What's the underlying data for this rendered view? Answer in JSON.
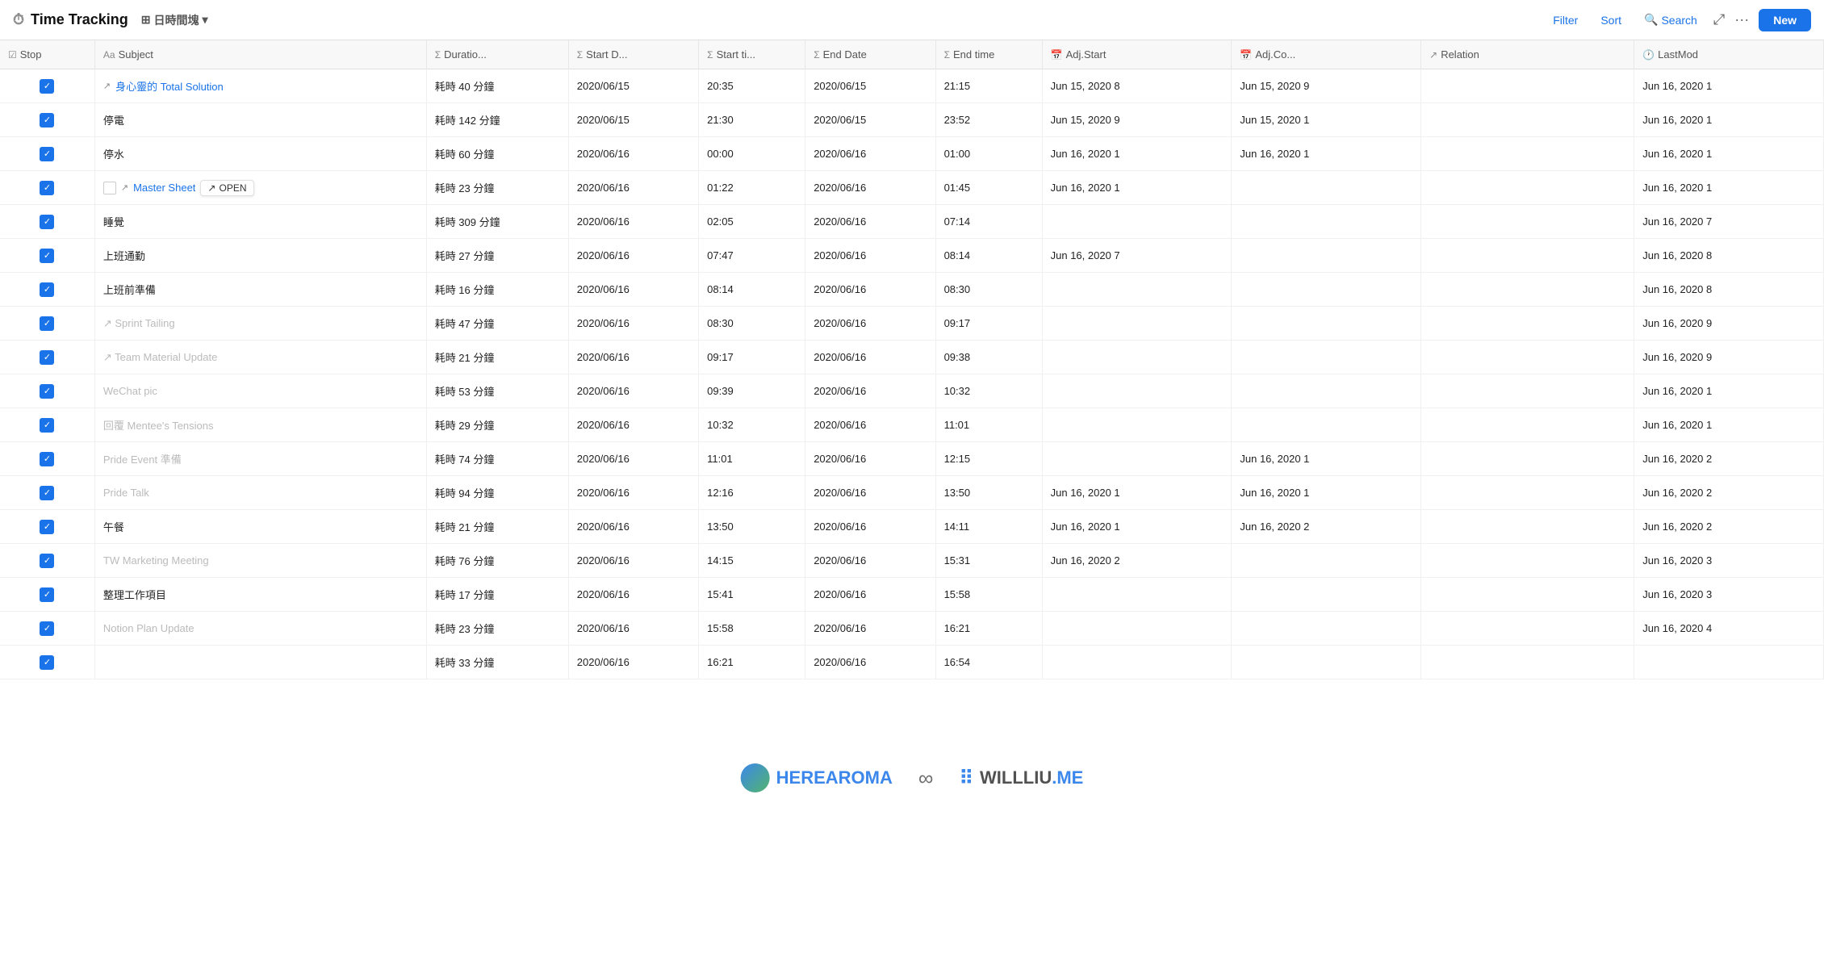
{
  "header": {
    "icon": "⏱",
    "title": "Time Tracking",
    "view_icon": "⊞",
    "view_label": "日時間塊",
    "view_dropdown": "▾",
    "filter_label": "Filter",
    "sort_label": "Sort",
    "search_icon": "🔍",
    "search_label": "Search",
    "expand_icon": "⤢",
    "more_icon": "···",
    "new_label": "New"
  },
  "columns": [
    {
      "id": "stop",
      "label": "Stop",
      "icon": "☑"
    },
    {
      "id": "subject",
      "label": "Subject",
      "icon": "Aa"
    },
    {
      "id": "duration",
      "label": "Duratio...",
      "icon": "Σ"
    },
    {
      "id": "startdate",
      "label": "Start D...",
      "icon": "Σ"
    },
    {
      "id": "starttime",
      "label": "Start ti...",
      "icon": "Σ"
    },
    {
      "id": "enddate",
      "label": "End Date",
      "icon": "Σ"
    },
    {
      "id": "endtime",
      "label": "End time",
      "icon": "Σ"
    },
    {
      "id": "adjstart",
      "label": "Adj.Start",
      "icon": "📅"
    },
    {
      "id": "adjco",
      "label": "Adj.Co...",
      "icon": "📅"
    },
    {
      "id": "relation",
      "label": "Relation",
      "icon": "↗"
    },
    {
      "id": "lastmod",
      "label": "LastMod",
      "icon": "🕐"
    }
  ],
  "rows": [
    {
      "checked": true,
      "subject": "↗ 身心靈的 Total Solution ↗",
      "subject_type": "linked",
      "duration": "耗時 40 分鐘",
      "startdate": "2020/06/15",
      "starttime": "20:35",
      "enddate": "2020/06/15",
      "endtime": "21:15",
      "adjstart": "Jun 15, 2020 8",
      "adjco": "Jun 15, 2020 9",
      "relation": "",
      "lastmod": "Jun 16, 2020 1"
    },
    {
      "checked": true,
      "subject": "停電",
      "subject_type": "normal",
      "duration": "耗時 142 分鐘",
      "startdate": "2020/06/15",
      "starttime": "21:30",
      "enddate": "2020/06/15",
      "endtime": "23:52",
      "adjstart": "Jun 15, 2020 9",
      "adjco": "Jun 15, 2020 1",
      "relation": "",
      "lastmod": "Jun 16, 2020 1"
    },
    {
      "checked": true,
      "subject": "停水",
      "subject_type": "normal",
      "duration": "耗時 60 分鐘",
      "startdate": "2020/06/16",
      "starttime": "00:00",
      "enddate": "2020/06/16",
      "endtime": "01:00",
      "adjstart": "Jun 16, 2020 1",
      "adjco": "Jun 16, 2020 1",
      "relation": "",
      "lastmod": "Jun 16, 2020 1"
    },
    {
      "checked": true,
      "subject": "↗ Master Sheet",
      "subject_type": "linked_open",
      "duration": "耗時 23 分鐘",
      "startdate": "2020/06/16",
      "starttime": "01:22",
      "enddate": "2020/06/16",
      "endtime": "01:45",
      "adjstart": "Jun 16, 2020 1",
      "adjco": "",
      "relation": "",
      "lastmod": "Jun 16, 2020 1"
    },
    {
      "checked": true,
      "subject": "睡覺",
      "subject_type": "normal",
      "duration": "耗時 309 分鐘",
      "startdate": "2020/06/16",
      "starttime": "02:05",
      "enddate": "2020/06/16",
      "endtime": "07:14",
      "adjstart": "",
      "adjco": "",
      "relation": "",
      "lastmod": "Jun 16, 2020 7"
    },
    {
      "checked": true,
      "subject": "上班通勤",
      "subject_type": "normal",
      "duration": "耗時 27 分鐘",
      "startdate": "2020/06/16",
      "starttime": "07:47",
      "enddate": "2020/06/16",
      "endtime": "08:14",
      "adjstart": "Jun 16, 2020 7",
      "adjco": "",
      "relation": "",
      "lastmod": "Jun 16, 2020 8"
    },
    {
      "checked": true,
      "subject": "上班前準備",
      "subject_type": "normal",
      "duration": "耗時 16 分鐘",
      "startdate": "2020/06/16",
      "starttime": "08:14",
      "enddate": "2020/06/16",
      "endtime": "08:30",
      "adjstart": "",
      "adjco": "",
      "relation": "",
      "lastmod": "Jun 16, 2020 8"
    },
    {
      "checked": true,
      "subject": "↗ Sprint Tailing",
      "subject_type": "blurred",
      "duration": "耗時 47 分鐘",
      "startdate": "2020/06/16",
      "starttime": "08:30",
      "enddate": "2020/06/16",
      "endtime": "09:17",
      "adjstart": "",
      "adjco": "",
      "relation": "",
      "lastmod": "Jun 16, 2020 9"
    },
    {
      "checked": true,
      "subject": "↗ Team Material Update",
      "subject_type": "blurred",
      "duration": "耗時 21 分鐘",
      "startdate": "2020/06/16",
      "starttime": "09:17",
      "enddate": "2020/06/16",
      "endtime": "09:38",
      "adjstart": "",
      "adjco": "",
      "relation": "",
      "lastmod": "Jun 16, 2020 9"
    },
    {
      "checked": true,
      "subject": "WeChat pic",
      "subject_type": "blurred",
      "duration": "耗時 53 分鐘",
      "startdate": "2020/06/16",
      "starttime": "09:39",
      "enddate": "2020/06/16",
      "endtime": "10:32",
      "adjstart": "",
      "adjco": "",
      "relation": "",
      "lastmod": "Jun 16, 2020 1"
    },
    {
      "checked": true,
      "subject": "回覆 Mentee's Tensions",
      "subject_type": "blurred",
      "duration": "耗時 29 分鐘",
      "startdate": "2020/06/16",
      "starttime": "10:32",
      "enddate": "2020/06/16",
      "endtime": "11:01",
      "adjstart": "",
      "adjco": "",
      "relation": "",
      "lastmod": "Jun 16, 2020 1"
    },
    {
      "checked": true,
      "subject": "Pride Event 準備",
      "subject_type": "blurred",
      "duration": "耗時 74 分鐘",
      "startdate": "2020/06/16",
      "starttime": "11:01",
      "enddate": "2020/06/16",
      "endtime": "12:15",
      "adjstart": "",
      "adjco": "Jun 16, 2020 1",
      "relation": "",
      "lastmod": "Jun 16, 2020 2"
    },
    {
      "checked": true,
      "subject": "Pride Talk",
      "subject_type": "blurred",
      "duration": "耗時 94 分鐘",
      "startdate": "2020/06/16",
      "starttime": "12:16",
      "enddate": "2020/06/16",
      "endtime": "13:50",
      "adjstart": "Jun 16, 2020 1",
      "adjco": "Jun 16, 2020 1",
      "relation": "",
      "lastmod": "Jun 16, 2020 2"
    },
    {
      "checked": true,
      "subject": "午餐",
      "subject_type": "normal",
      "duration": "耗時 21 分鐘",
      "startdate": "2020/06/16",
      "starttime": "13:50",
      "enddate": "2020/06/16",
      "endtime": "14:11",
      "adjstart": "Jun 16, 2020 1",
      "adjco": "Jun 16, 2020 2",
      "relation": "",
      "lastmod": "Jun 16, 2020 2"
    },
    {
      "checked": true,
      "subject": "TW Marketing Meeting",
      "subject_type": "blurred",
      "duration": "耗時 76 分鐘",
      "startdate": "2020/06/16",
      "starttime": "14:15",
      "enddate": "2020/06/16",
      "endtime": "15:31",
      "adjstart": "Jun 16, 2020 2",
      "adjco": "",
      "relation": "",
      "lastmod": "Jun 16, 2020 3"
    },
    {
      "checked": true,
      "subject": "整理工作項目",
      "subject_type": "normal",
      "duration": "耗時 17 分鐘",
      "startdate": "2020/06/16",
      "starttime": "15:41",
      "enddate": "2020/06/16",
      "endtime": "15:58",
      "adjstart": "",
      "adjco": "",
      "relation": "",
      "lastmod": "Jun 16, 2020 3"
    },
    {
      "checked": true,
      "subject": "Notion Plan Update",
      "subject_type": "blurred",
      "duration": "耗時 23 分鐘",
      "startdate": "2020/06/16",
      "starttime": "15:58",
      "enddate": "2020/06/16",
      "endtime": "16:21",
      "adjstart": "",
      "adjco": "",
      "relation": "",
      "lastmod": "Jun 16, 2020 4"
    },
    {
      "checked": true,
      "subject": "",
      "subject_type": "blurred",
      "duration": "耗時 33 分鐘",
      "startdate": "2020/06/16",
      "starttime": "16:21",
      "enddate": "2020/06/16",
      "endtime": "16:54",
      "adjstart": "",
      "adjco": "",
      "relation": "",
      "lastmod": ""
    }
  ],
  "watermark": {
    "left_text": "HEREAROMA",
    "infinity": "∞",
    "right_text": "WILLLIU.ME"
  }
}
